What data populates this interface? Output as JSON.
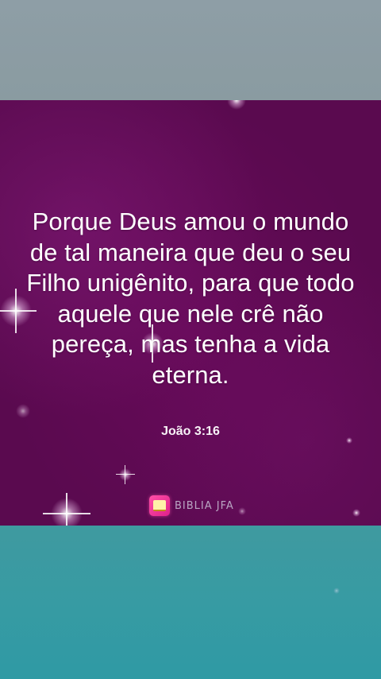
{
  "post": {
    "verse_text": "Porque Deus amou o mundo de tal maneira que deu o seu Filho unigênito, para que todo aquele que nele crê não pereça, mas tenha a vida eterna.",
    "reference": "João 3:16"
  },
  "branding": {
    "logo_text": "BIBLIA JFA",
    "logo_icon": "book-icon"
  },
  "colors": {
    "top_band": "#8e9ea6",
    "card_background": "#5a0a4f",
    "bottom_band": "#379ba3",
    "text": "#ffffff",
    "logo_accent": "#e0208a"
  }
}
